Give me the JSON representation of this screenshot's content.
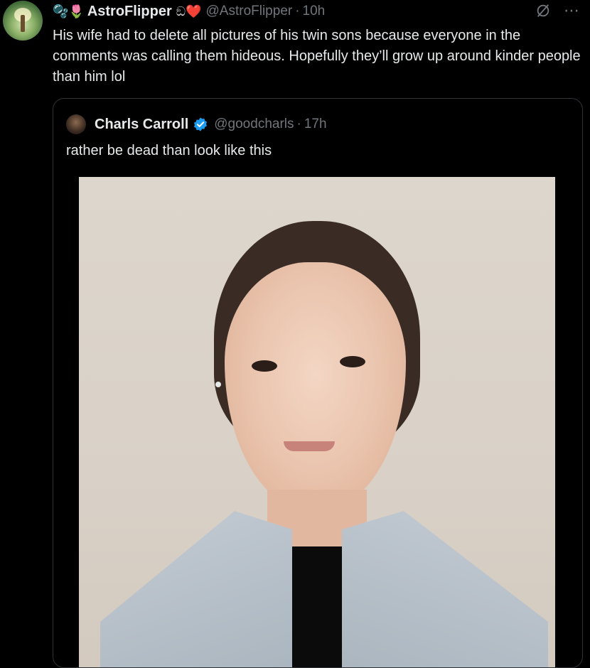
{
  "tweet": {
    "emoji_prefix": "🫧🌷",
    "display_name": "AstroFlipper",
    "name_badges": "ඞ❤️",
    "handle": "@AstroFlipper",
    "separator": "·",
    "time": "10h",
    "text": "His wife had to delete all pictures of his twin sons because everyone in the comments was calling them hideous. Hopefully they’ll grow up around kinder people than him lol"
  },
  "quoted": {
    "display_name": "Charls Carroll",
    "handle": "@goodcharls",
    "separator": "·",
    "time": "17h",
    "text": "rather be dead than look like this"
  },
  "icons": {
    "grok": "grok-icon",
    "more": "more-icon",
    "verified": "verified-badge-icon",
    "verified_color": "#1d9bf0"
  },
  "colors": {
    "background": "#000000",
    "text": "#e7e9ea",
    "secondary": "#71767b",
    "border": "#2f3336"
  }
}
